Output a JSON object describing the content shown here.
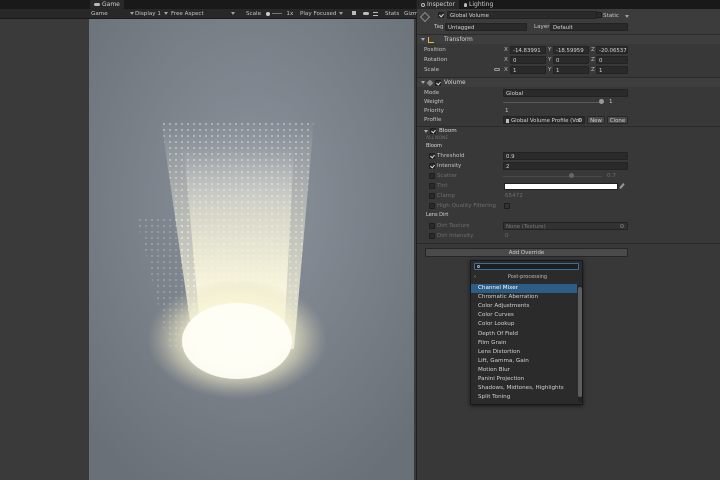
{
  "game_tab": {
    "icon": "gamepad-icon",
    "label": "Game"
  },
  "game_toolbar": {
    "view": "Game",
    "display": "Display 1",
    "aspect": "Free Aspect",
    "scale_label": "Scale",
    "scale_value": "1x",
    "play_mode": "Play Focused",
    "stats": "Stats",
    "gizmos": "Gizm"
  },
  "inspector_tabs": [
    {
      "label": "Inspector",
      "icon": "info-icon"
    },
    {
      "label": "Lighting",
      "icon": "lightbulb-icon"
    }
  ],
  "object": {
    "name": "Global Volume",
    "static_label": "Static",
    "tag_label": "Tag",
    "tag_value": "Untagged",
    "layer_label": "Layer",
    "layer_value": "Default"
  },
  "transform": {
    "title": "Transform",
    "position_label": "Position",
    "rotation_label": "Rotation",
    "scale_label": "Scale",
    "position": {
      "x": "-14.83991",
      "y": "-18.59959",
      "z": "-20.06537"
    },
    "rotation": {
      "x": "0",
      "y": "0",
      "z": "0"
    },
    "scale": {
      "x": "1",
      "y": "1",
      "z": "1"
    },
    "axis": {
      "x": "X",
      "y": "Y",
      "z": "Z"
    }
  },
  "volume": {
    "title": "Volume",
    "mode_label": "Mode",
    "mode_value": "Global",
    "weight_label": "Weight",
    "weight_value": "1",
    "weight_fraction": 1.0,
    "priority_label": "Priority",
    "priority_value": "1",
    "profile_label": "Profile",
    "profile_value": "Global Volume Profile (Vol",
    "new_button": "New",
    "clone_button": "Clone"
  },
  "bloom": {
    "title": "Bloom",
    "all_none": "ALL  NONE",
    "section_bloom": "Bloom",
    "threshold_label": "Threshold",
    "threshold_value": "0.9",
    "intensity_label": "Intensity",
    "intensity_value": "2",
    "scatter_label": "Scatter",
    "scatter_value": "0.7",
    "scatter_fraction": 0.7,
    "tint_label": "Tint",
    "tint_color": "#ffffff",
    "clamp_label": "Clamp",
    "clamp_value": "65472",
    "hq_label": "High Quality Filtering",
    "section_lens_dirt": "Lens Dirt",
    "dirt_texture_label": "Dirt Texture",
    "dirt_texture_value": "None (Texture)",
    "dirt_intensity_label": "Dirt Intensity",
    "dirt_intensity_value": "0"
  },
  "add_override": "Add Override",
  "dropdown": {
    "search_placeholder": "",
    "title": "Post-processing",
    "items": [
      "Channel Mixer",
      "Chromatic Aberration",
      "Color Adjustments",
      "Color Curves",
      "Color Lookup",
      "Depth Of Field",
      "Film Grain",
      "Lens Distortion",
      "Lift, Gamma, Gain",
      "Motion Blur",
      "Panini Projection",
      "Shadows, Midtones, Highlights",
      "Split Toning"
    ],
    "selected_index": 0
  },
  "colors": {
    "scene_bg": "#727882",
    "selection": "#2c5d87",
    "glow": "#fffbe0"
  }
}
